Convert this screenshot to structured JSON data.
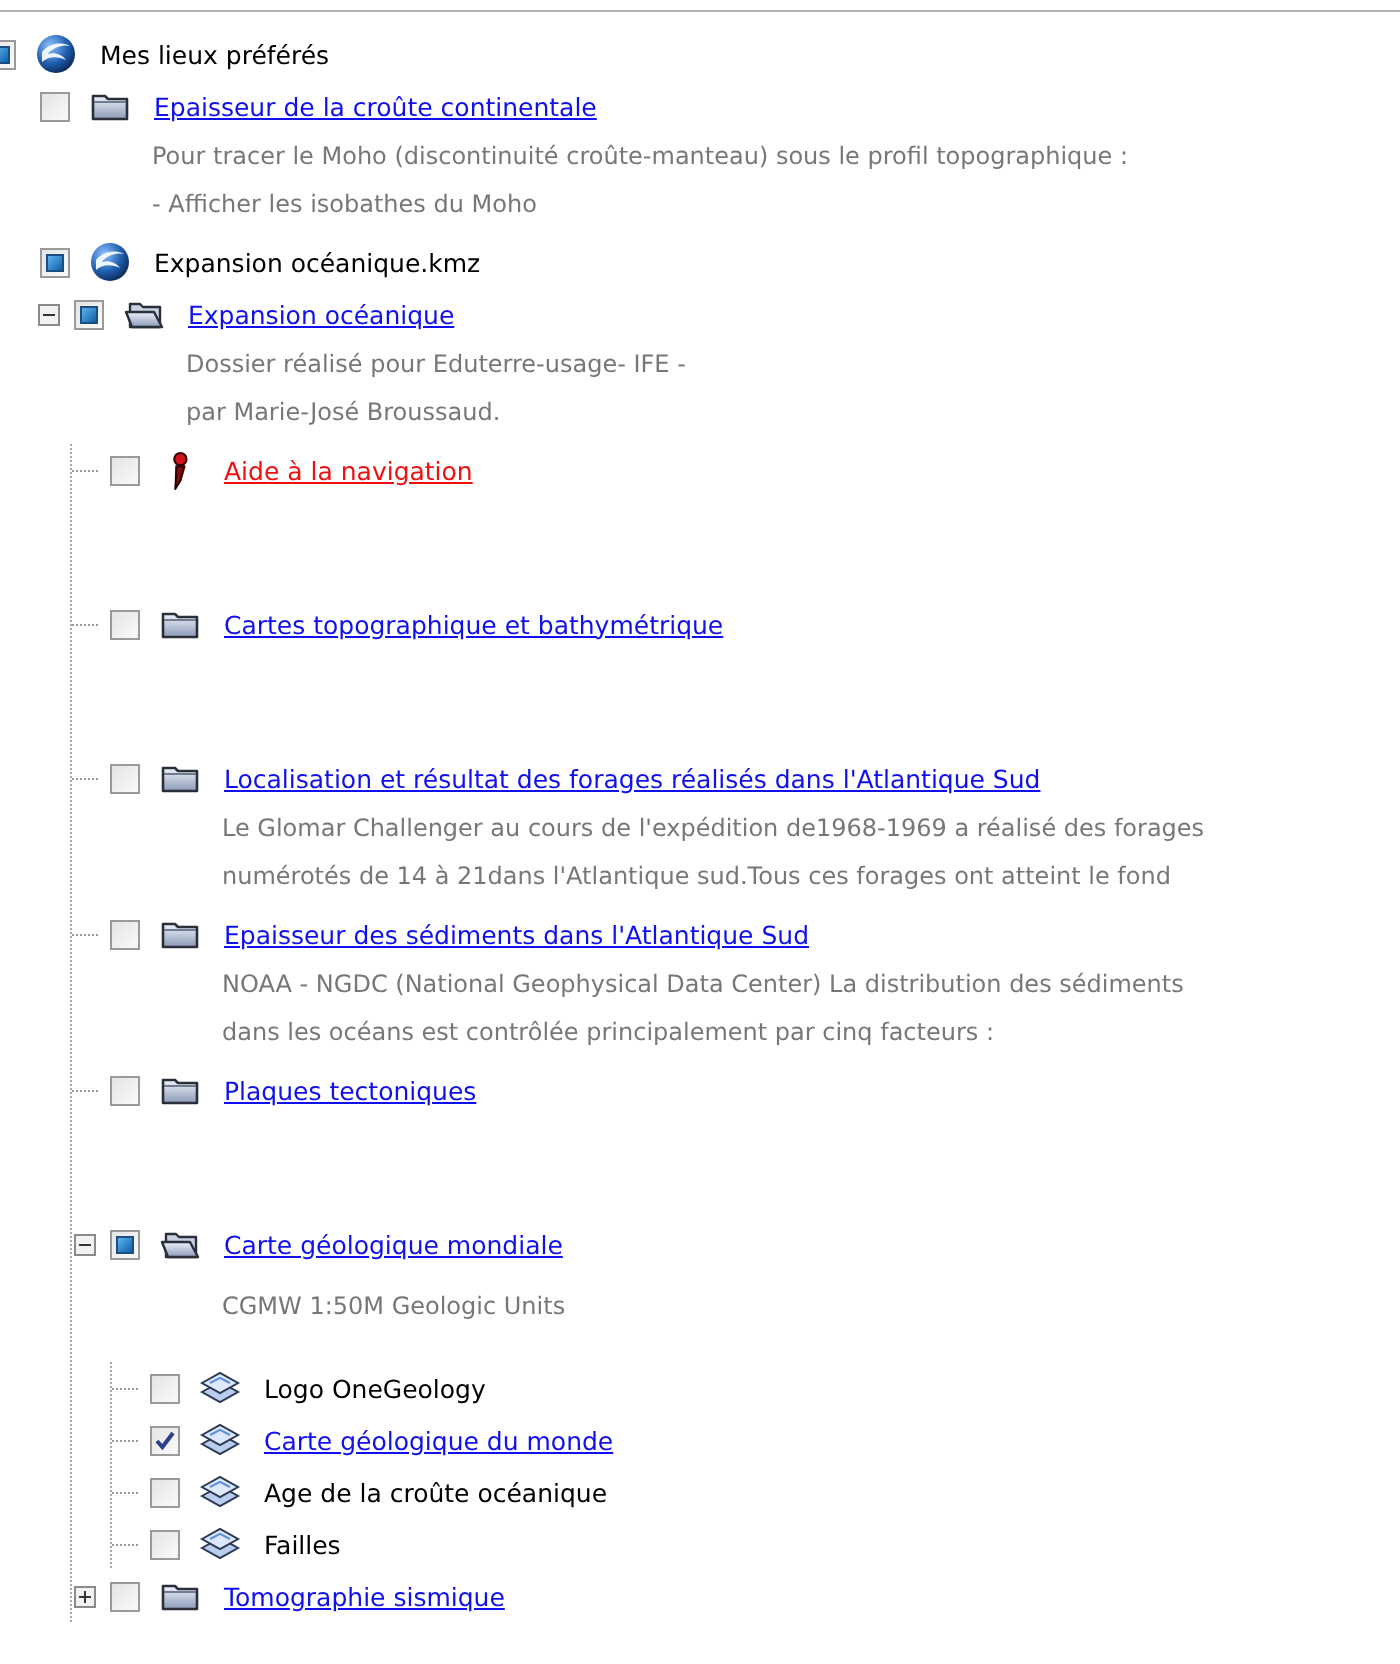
{
  "places": [
    {
      "label": "Mes lieux préférés",
      "kind": "earth",
      "link": false,
      "color": "#000000",
      "checked": false,
      "partial": true,
      "children": [
        {
          "label": "Epaisseur de la croûte continentale",
          "kind": "folder",
          "link": true,
          "color": "#1010ee",
          "checked": false,
          "partial": false,
          "description": [
            "Pour tracer le Moho (discontinuité croûte-manteau) sous le profil topographique :",
            "- Afficher les isobathes du Moho"
          ]
        },
        {
          "label": "Expansion océanique.kmz",
          "kind": "earth",
          "link": false,
          "color": "#000000",
          "checked": false,
          "partial": true,
          "children": [
            {
              "label": "Expansion océanique",
              "kind": "folder-open",
              "link": true,
              "color": "#1010ee",
              "expanded": true,
              "checked": false,
              "partial": true,
              "description": [
                "Dossier réalisé pour Eduterre-usage- IFE -",
                "par Marie-José Broussaud."
              ],
              "children": [
                {
                  "label": "Aide à la navigation",
                  "kind": "pin",
                  "link": true,
                  "color": "#ee1010",
                  "checked": false,
                  "partial": false
                },
                {
                  "label": "Cartes topographique et bathymétrique",
                  "kind": "folder",
                  "link": true,
                  "color": "#1010ee",
                  "checked": false,
                  "partial": false
                },
                {
                  "label": "Localisation et résultat des forages réalisés dans l'Atlantique Sud",
                  "kind": "folder",
                  "link": true,
                  "color": "#1010ee",
                  "checked": false,
                  "partial": false,
                  "description": [
                    "Le Glomar Challenger au cours de l'expédition de1968-1969 a réalisé des forages",
                    "numérotés de 14 à 21dans l'Atlantique sud.Tous ces forages ont atteint le fond"
                  ]
                },
                {
                  "label": "Epaisseur des sédiments dans l'Atlantique Sud",
                  "kind": "folder",
                  "link": true,
                  "color": "#1010ee",
                  "checked": false,
                  "partial": false,
                  "description": [
                    "NOAA - NGDC (National Geophysical Data Center) La distribution des sédiments",
                    "dans les océans est contrôlée principalement par cinq facteurs :"
                  ]
                },
                {
                  "label": "Plaques tectoniques",
                  "kind": "folder",
                  "link": true,
                  "color": "#1010ee",
                  "checked": false,
                  "partial": false
                },
                {
                  "label": "Carte géologique mondiale",
                  "kind": "folder-open",
                  "link": true,
                  "color": "#1010ee",
                  "expanded": true,
                  "checked": false,
                  "partial": true,
                  "description": [
                    "CGMW 1:50M Geologic Units"
                  ],
                  "children": [
                    {
                      "label": "Logo OneGeology",
                      "kind": "layer",
                      "link": false,
                      "color": "#000000",
                      "checked": false,
                      "partial": false
                    },
                    {
                      "label": "Carte géologique du monde",
                      "kind": "layer",
                      "link": true,
                      "color": "#1010ee",
                      "checked": true
                    },
                    {
                      "label": "Age de la croûte océanique",
                      "kind": "layer",
                      "link": false,
                      "color": "#000000",
                      "checked": false,
                      "partial": false
                    },
                    {
                      "label": "Failles",
                      "kind": "layer",
                      "link": false,
                      "color": "#000000",
                      "checked": false,
                      "partial": false
                    }
                  ]
                },
                {
                  "label": "Tomographie sismique",
                  "kind": "folder",
                  "link": true,
                  "color": "#1010ee",
                  "expanded": false,
                  "checked": false,
                  "partial": false
                }
              ]
            }
          ]
        }
      ]
    }
  ]
}
